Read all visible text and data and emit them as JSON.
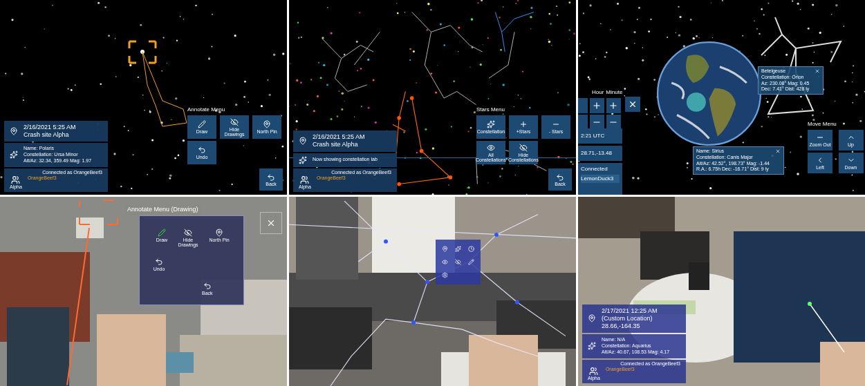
{
  "top_left": {
    "info": {
      "datetime": "2/16/2021 5:25 AM",
      "location": "Crash site Alpha",
      "star_lines": [
        "Name: Polaris",
        "Constellation: Ursa Minor",
        "Alt/Az: 32.34, 359.49  Mag: 1.97"
      ],
      "connection": "Connected as OrangeBeef3",
      "user": "OrangeBeef3",
      "group": "Alpha"
    },
    "menu": {
      "title": "Annotate Menu",
      "buttons": [
        {
          "kind": "draw",
          "label": "Draw"
        },
        {
          "kind": "hide",
          "label": "Hide Drawings"
        },
        {
          "kind": "pin",
          "label": "North Pin"
        },
        {
          "kind": "undo",
          "label": "Undo"
        }
      ],
      "back": "Back"
    }
  },
  "top_middle": {
    "info": {
      "datetime": "2/16/2021 5:25 AM",
      "location": "Crash site Alpha",
      "star_lines": [
        "Now showing constellation lab"
      ],
      "connection": "Connected as OrangeBeef3",
      "user": "OrangeBeef3",
      "group": "Alpha"
    },
    "menu": {
      "title": "Stars Menu",
      "buttons": [
        {
          "kind": "constellation",
          "label": "Constellation"
        },
        {
          "kind": "plus",
          "label": "+Stars"
        },
        {
          "kind": "minus",
          "label": "- Stars"
        },
        {
          "kind": "show",
          "label": "All Constellations"
        },
        {
          "kind": "hide",
          "label": "Hide Constellations"
        }
      ],
      "back": "Back"
    }
  },
  "top_right": {
    "time_labels": [
      "Hour",
      "Minute"
    ],
    "time_readout": "2:21 UTC",
    "coordinates": "28.71,-13.48",
    "status": "Connected",
    "user": "LemonDuck3",
    "popups": [
      {
        "lines": [
          "Betelgeuse",
          "Constellation: Orion",
          "Az: 230.08°  Mag: 0.45",
          "Dec: 7.41°  Dist: 428 ly"
        ]
      },
      {
        "lines": [
          "Name: Sirius",
          "Constellation: Canis Major",
          "Alt/Az: 42.52°, 198.73°  Mag: -1.44",
          "R.A.: 6.75h  Dec: -16.71°  Dist: 9 ly"
        ]
      }
    ],
    "menu": {
      "title": "Move Menu",
      "buttons": [
        {
          "kind": "minus",
          "label": "Zoom Out"
        },
        {
          "kind": "up",
          "label": "Up"
        },
        {
          "kind": "left",
          "label": "Left"
        },
        {
          "kind": "down",
          "label": "Down"
        }
      ]
    }
  },
  "bottom_left": {
    "menu": {
      "title": "Annotate Menu (Drawing)",
      "buttons": [
        {
          "kind": "draw",
          "label": "Draw"
        },
        {
          "kind": "hide",
          "label": "Hide Drawings"
        },
        {
          "kind": "pin",
          "label": "North Pin"
        },
        {
          "kind": "undo",
          "label": "Undo"
        }
      ],
      "back": "Back"
    }
  },
  "bottom_middle": {
    "menu": {
      "buttons": [
        {
          "kind": "pin"
        },
        {
          "kind": "constellation"
        },
        {
          "kind": "time"
        },
        {
          "kind": "show"
        },
        {
          "kind": "hide"
        },
        {
          "kind": "draw"
        },
        {
          "kind": "settings"
        }
      ]
    }
  },
  "bottom_right": {
    "info": {
      "datetime": "2/17/2021 12:25 AM",
      "location": "(Custom Location)",
      "coordinates": "28.66,-164.35",
      "star_lines": [
        "Name: N/A",
        "Constellation: Aquarius",
        "Alt/Az: 40.67, 108.53  Mag: 4.17"
      ],
      "connection": "Connected as OrangeBeef3",
      "user": "OrangeBeef3",
      "group": "Alpha"
    }
  }
}
